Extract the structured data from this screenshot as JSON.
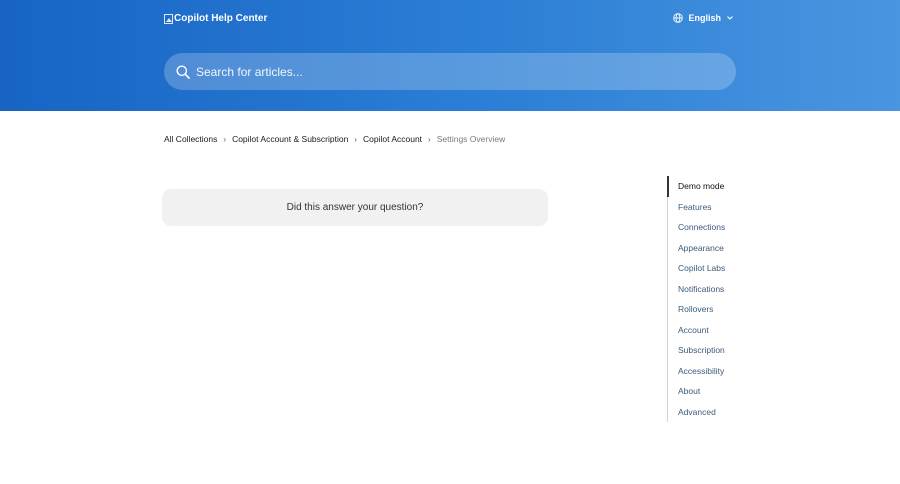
{
  "header": {
    "logo_alt": "Copilot Help Center",
    "language": "English"
  },
  "search": {
    "placeholder": "Search for articles..."
  },
  "breadcrumb": {
    "items": [
      "All Collections",
      "Copilot Account & Subscription",
      "Copilot Account"
    ],
    "current": "Settings Overview"
  },
  "feedback": {
    "question": "Did this answer your question?"
  },
  "toc": {
    "items": [
      "Demo mode",
      "Features",
      "Connections",
      "Appearance",
      "Copilot Labs",
      "Notifications",
      "Rollovers",
      "Account",
      "Subscription",
      "Accessibility",
      "About",
      "Advanced"
    ]
  },
  "colors": {
    "header_gradient_start": "#1764c4",
    "header_gradient_end": "#4a95e0",
    "feedback_bg": "#f1f1f1"
  }
}
